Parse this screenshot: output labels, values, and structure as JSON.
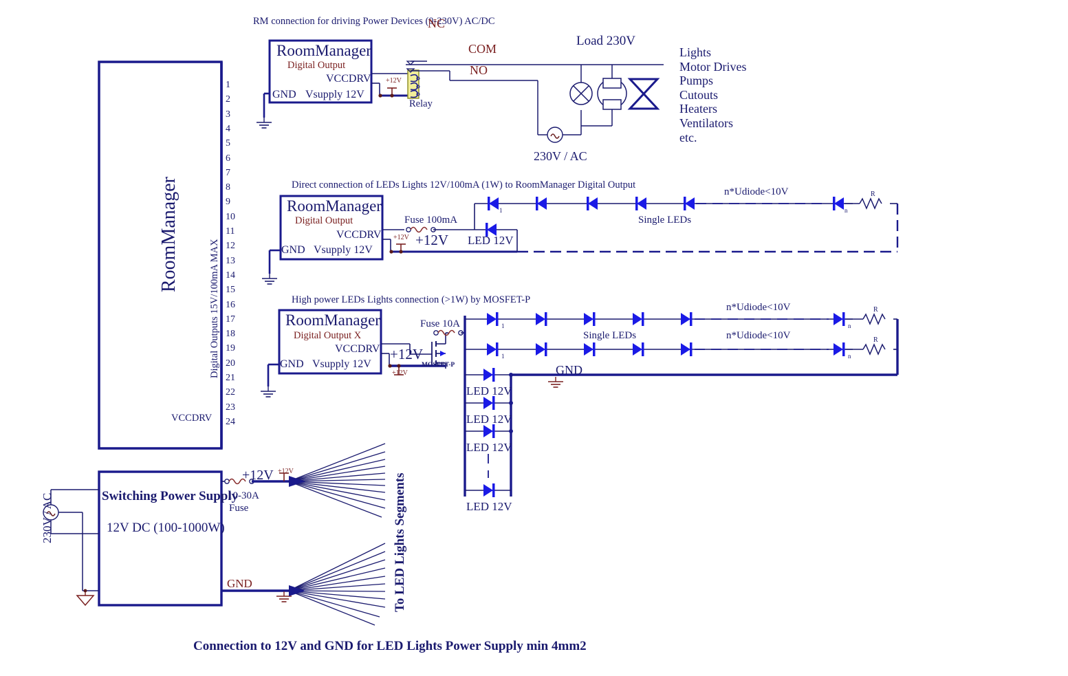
{
  "diagram": {
    "title_top": "RM connection for driving Power Devices (0-230V) AC/DC",
    "caption_bottom": "Connection  to 12V and GND for  LED Lights Power Supply min 4mm2"
  },
  "main_block": {
    "name": "RoomManager",
    "side_label": "Digital Outputs 15V/100mA MAX",
    "vccdrv_label": "VCCDRV",
    "pins": [
      "1",
      "2",
      "3",
      "4",
      "5",
      "6",
      "7",
      "8",
      "9",
      "10",
      "11",
      "12",
      "13",
      "14",
      "15",
      "16",
      "17",
      "18",
      "19",
      "20",
      "21",
      "22",
      "23",
      "24"
    ]
  },
  "section1": {
    "title": "RM connection for driving Power Devices (0-230V) AC/DC",
    "block": {
      "name": "RoomManager",
      "digital_output": "Digital Output",
      "vccdrv": "VCCDRV",
      "gnd": "GND",
      "vsupply": "Vsupply 12V"
    },
    "supply_tag": "+12V",
    "relay_label": "Relay",
    "contacts": {
      "nc": "NC",
      "com": "COM",
      "no": "NO"
    },
    "load_label": "Load 230V",
    "source_label": "230V / AC",
    "load_list": [
      "Lights",
      "Motor Drives",
      "Pumps",
      "Cutouts",
      "Heaters",
      "Ventilators",
      "etc."
    ]
  },
  "section2": {
    "title": "Direct connection of LEDs Lights 12V/100mA (1W) to RoomManager Digital Output",
    "block": {
      "name": "RoomManager",
      "digital_output": "Digital Output",
      "vccdrv": "VCCDRV",
      "gnd": "GND",
      "vsupply": "Vsupply 12V"
    },
    "supply_tag": "+12V",
    "rail_label": "+12V",
    "fuse_label": "Fuse 100mA",
    "led_label": "LED 12V",
    "chain_label": "Single LEDs",
    "voltage_note": "n*Udiode<10V",
    "first_index": "1",
    "last_index": "n",
    "resistor_label": "R"
  },
  "section3": {
    "title": "High power LEDs Lights connection  (>1W) by MOSFET-P",
    "block": {
      "name": "RoomManager",
      "digital_output": "Digital Output X",
      "vccdrv": "VCCDRV",
      "gnd": "GND",
      "vsupply": "Vsupply 12V"
    },
    "supply_tag": "+12V",
    "rail_label": "+12V",
    "fuse_label": "Fuse 10A",
    "mosfet_label": "MOSFET-P",
    "chain_label": "Single LEDs",
    "voltage_note_1": "n*Udiode<10V",
    "voltage_note_2": "n*Udiode<10V",
    "first_index": "1",
    "last_index": "n",
    "resistor_label": "R",
    "gnd_label": "GND",
    "vertical_leds": [
      "LED 12V",
      "LED 12V",
      "LED 12V",
      "LED 12V"
    ]
  },
  "psu": {
    "title": "Switching Power Supply",
    "subtitle": "12V DC (100-1000W)",
    "ac_label": "230V / AC",
    "fuse_label_1": "10-30A",
    "fuse_label_2": "Fuse",
    "out_12v": "+12V",
    "tag_12v": "+12V",
    "out_gnd": "GND",
    "fanout_label": "To LED Lights Segments"
  },
  "colors": {
    "wire": "#1a1a8c",
    "thin_wire": "#1a1a6e",
    "text": "#1a1a6e",
    "red_text": "#7a2020",
    "relay_body": "#f2ee9a",
    "diode": "#1a1ae6",
    "background": "#ffffff"
  }
}
